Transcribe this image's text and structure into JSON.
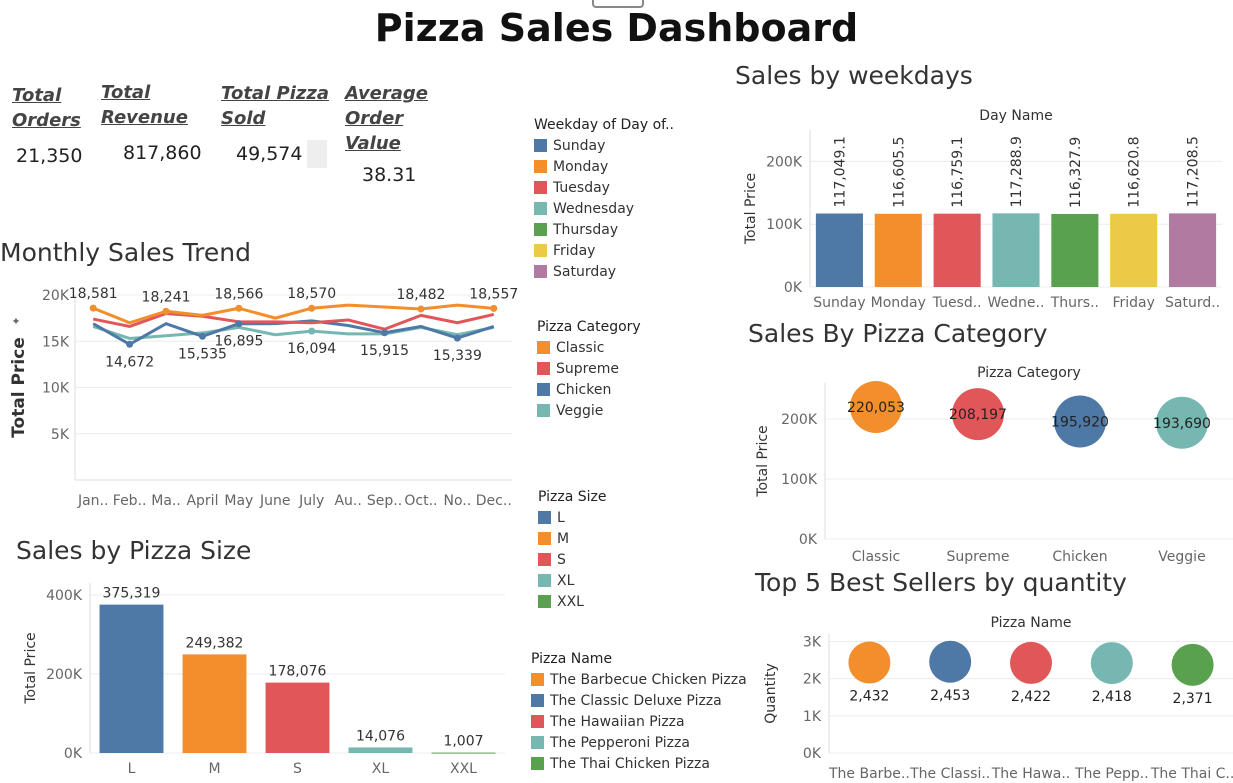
{
  "header": {
    "title": "Pizza Sales Dashboard"
  },
  "kpis": [
    {
      "label_lines": [
        "Total",
        "Orders"
      ],
      "value": "21,350"
    },
    {
      "label_lines": [
        "Total",
        "Revenue"
      ],
      "value": "817,860"
    },
    {
      "label_lines": [
        "Total Pizza",
        "Sold"
      ],
      "value": "49,574"
    },
    {
      "label_lines": [
        "Average",
        "Order",
        "Value"
      ],
      "value": "38.31"
    }
  ],
  "colors": {
    "blue": "#4e79a7",
    "orange": "#f28e2b",
    "red": "#e15759",
    "teal": "#76b7b2",
    "green": "#59a14f",
    "yellow": "#edc948",
    "purple": "#b07aa1"
  },
  "legends": {
    "weekday": {
      "title": "Weekday of Day of..",
      "items": [
        {
          "label": "Sunday",
          "color": "#4e79a7"
        },
        {
          "label": "Monday",
          "color": "#f28e2b"
        },
        {
          "label": "Tuesday",
          "color": "#e15759"
        },
        {
          "label": "Wednesday",
          "color": "#76b7b2"
        },
        {
          "label": "Thursday",
          "color": "#59a14f"
        },
        {
          "label": "Friday",
          "color": "#edc948"
        },
        {
          "label": "Saturday",
          "color": "#b07aa1"
        }
      ]
    },
    "category": {
      "title": "Pizza Category",
      "items": [
        {
          "label": "Classic",
          "color": "#f28e2b"
        },
        {
          "label": "Supreme",
          "color": "#e15759"
        },
        {
          "label": "Chicken",
          "color": "#4e79a7"
        },
        {
          "label": "Veggie",
          "color": "#76b7b2"
        }
      ]
    },
    "size": {
      "title": "Pizza Size",
      "items": [
        {
          "label": "L",
          "color": "#4e79a7"
        },
        {
          "label": "M",
          "color": "#f28e2b"
        },
        {
          "label": "S",
          "color": "#e15759"
        },
        {
          "label": "XL",
          "color": "#76b7b2"
        },
        {
          "label": "XXL",
          "color": "#59a14f"
        }
      ]
    },
    "name": {
      "title": "Pizza Name",
      "items": [
        {
          "label": "The Barbecue Chicken Pizza",
          "color": "#f28e2b"
        },
        {
          "label": "The Classic Deluxe Pizza",
          "color": "#4e79a7"
        },
        {
          "label": "The Hawaiian Pizza",
          "color": "#e15759"
        },
        {
          "label": "The Pepperoni Pizza",
          "color": "#76b7b2"
        },
        {
          "label": "The Thai Chicken Pizza",
          "color": "#59a14f"
        }
      ]
    }
  },
  "chart_data": [
    {
      "id": "monthly",
      "type": "line",
      "title": "Monthly Sales Trend",
      "ylabel": "Total Price",
      "ylim": [
        0,
        20000
      ],
      "yticks": [
        "5K",
        "10K",
        "15K",
        "20K"
      ],
      "categories": [
        "Jan..",
        "Feb..",
        "Ma..",
        "April",
        "May",
        "June",
        "July",
        "Au..",
        "Sep..",
        "Oct..",
        "No..",
        "Dec.."
      ],
      "series": [
        {
          "name": "Classic",
          "color": "#f28e2b",
          "values": [
            18581,
            17000,
            18241,
            17800,
            18566,
            17500,
            18570,
            18900,
            18700,
            18482,
            18900,
            18557
          ]
        },
        {
          "name": "Supreme",
          "color": "#e15759",
          "values": [
            17400,
            16600,
            18000,
            17700,
            17100,
            17100,
            17000,
            17300,
            16300,
            17800,
            17000,
            17900
          ]
        },
        {
          "name": "Chicken",
          "color": "#4e79a7",
          "values": [
            16900,
            14672,
            16900,
            15535,
            16895,
            16900,
            17200,
            16700,
            15915,
            16600,
            15339,
            16600
          ]
        },
        {
          "name": "Veggie",
          "color": "#76b7b2",
          "values": [
            16600,
            15300,
            15600,
            15900,
            16500,
            15700,
            16094,
            15800,
            15800,
            16500,
            15700,
            16500
          ]
        }
      ],
      "annotations": [
        {
          "text": "18,581",
          "series": 0,
          "index": 0,
          "pos": "above"
        },
        {
          "text": "18,241",
          "series": 0,
          "index": 2,
          "pos": "above"
        },
        {
          "text": "18,566",
          "series": 0,
          "index": 4,
          "pos": "above"
        },
        {
          "text": "18,570",
          "series": 0,
          "index": 6,
          "pos": "above"
        },
        {
          "text": "18,482",
          "series": 0,
          "index": 9,
          "pos": "above"
        },
        {
          "text": "18,557",
          "series": 0,
          "index": 11,
          "pos": "above"
        },
        {
          "text": "14,672",
          "series": 2,
          "index": 1,
          "pos": "below"
        },
        {
          "text": "15,535",
          "series": 2,
          "index": 3,
          "pos": "below"
        },
        {
          "text": "16,895",
          "series": 2,
          "index": 4,
          "pos": "below"
        },
        {
          "text": "16,094",
          "series": 3,
          "index": 6,
          "pos": "below"
        },
        {
          "text": "15,915",
          "series": 2,
          "index": 8,
          "pos": "below"
        },
        {
          "text": "15,339",
          "series": 2,
          "index": 10,
          "pos": "below"
        }
      ]
    },
    {
      "id": "weekday",
      "type": "bar",
      "title": "Sales by weekdays",
      "header": "Day Name",
      "ylabel": "Total Price",
      "ylim": [
        0,
        250000
      ],
      "yticks": [
        "0K",
        "100K",
        "200K"
      ],
      "categories": [
        "Sunday",
        "Monday",
        "Tuesd..",
        "Wedne..",
        "Thurs..",
        "Friday",
        "Saturd.."
      ],
      "values": [
        117049.1,
        116605.5,
        116759.1,
        117288.9,
        116327.9,
        116620.8,
        117208.5
      ],
      "labels": [
        "117,049.1",
        "116,605.5",
        "116,759.1",
        "117,288.9",
        "116,327.9",
        "116,620.8",
        "117,208.5"
      ],
      "colors": [
        "#4e79a7",
        "#f28e2b",
        "#e15759",
        "#76b7b2",
        "#59a14f",
        "#edc948",
        "#b07aa1"
      ]
    },
    {
      "id": "category",
      "type": "scatter",
      "title": "Sales By Pizza Category",
      "header": "Pizza Category",
      "ylabel": "Total Price",
      "ylim": [
        0,
        260000
      ],
      "yticks": [
        "0K",
        "100K",
        "200K"
      ],
      "categories": [
        "Classic",
        "Supreme",
        "Chicken",
        "Veggie"
      ],
      "values": [
        220053,
        208197,
        195920,
        193690
      ],
      "labels": [
        "220,053",
        "208,197",
        "195,920",
        "193,690"
      ],
      "colors": [
        "#f28e2b",
        "#e15759",
        "#4e79a7",
        "#76b7b2"
      ]
    },
    {
      "id": "size",
      "type": "bar",
      "title": "Sales by Pizza Size",
      "ylabel": "Total Price",
      "ylim": [
        0,
        430000
      ],
      "yticks": [
        "0K",
        "200K",
        "400K"
      ],
      "categories": [
        "L",
        "M",
        "S",
        "XL",
        "XXL"
      ],
      "values": [
        375319,
        249382,
        178076,
        14076,
        1007
      ],
      "labels": [
        "375,319",
        "249,382",
        "178,076",
        "14,076",
        "1,007"
      ],
      "colors": [
        "#4e79a7",
        "#f28e2b",
        "#e15759",
        "#76b7b2",
        "#59a14f"
      ]
    },
    {
      "id": "top5",
      "type": "scatter",
      "title": "Top 5 Best Sellers by quantity",
      "header": "Pizza Name",
      "ylabel": "Quantity",
      "ylim": [
        0,
        3200
      ],
      "yticks": [
        "0K",
        "1K",
        "2K",
        "3K"
      ],
      "categories": [
        "The Barbe..",
        "The Classi..",
        "The Hawa..",
        "The Pepp..",
        "The Thai C.."
      ],
      "values": [
        2432,
        2453,
        2422,
        2418,
        2371
      ],
      "labels": [
        "2,432",
        "2,453",
        "2,422",
        "2,418",
        "2,371"
      ],
      "colors": [
        "#f28e2b",
        "#4e79a7",
        "#e15759",
        "#76b7b2",
        "#59a14f"
      ]
    }
  ]
}
